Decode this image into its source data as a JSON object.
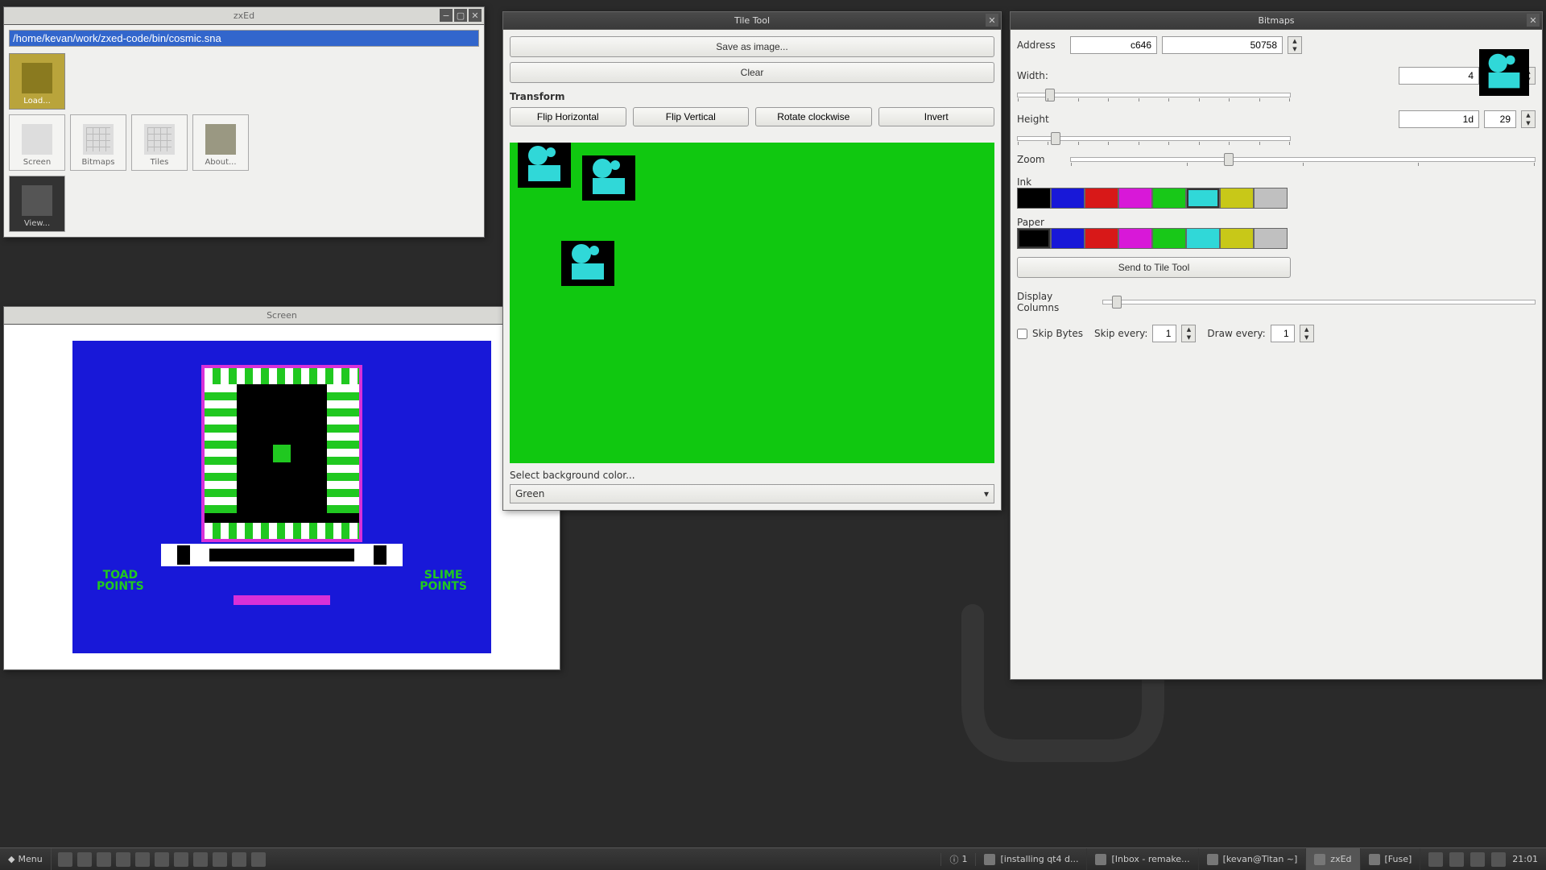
{
  "zxed": {
    "title": "zxEd",
    "path": "/home/kevan/work/zxed-code/bin/cosmic.sna",
    "tools": [
      {
        "label": "Load...",
        "active": true
      },
      {
        "label": "Screen"
      },
      {
        "label": "Bitmaps"
      },
      {
        "label": "Tiles"
      },
      {
        "label": "About..."
      },
      {
        "label": "View..."
      }
    ]
  },
  "screen": {
    "title": "Screen",
    "hud_left_1": "TOAD",
    "hud_left_2": "POINTS",
    "hud_right_1": "SLIME",
    "hud_right_2": "POINTS"
  },
  "tiletool": {
    "title": "Tile Tool",
    "save_label": "Save as image...",
    "clear_label": "Clear",
    "transform_label": "Transform",
    "flip_h": "Flip Horizontal",
    "flip_v": "Flip Vertical",
    "rotate": "Rotate clockwise",
    "invert": "Invert",
    "bg_label": "Select background color...",
    "bg_value": "Green"
  },
  "bitmaps": {
    "title": "Bitmaps",
    "address_label": "Address",
    "address_hex": "c646",
    "address_dec": "50758",
    "width_label": "Width:",
    "width_hex": "4",
    "width_dec": "4",
    "height_label": "Height",
    "height_hex": "1d",
    "height_dec": "29",
    "zoom_label": "Zoom",
    "ink_label": "Ink",
    "paper_label": "Paper",
    "send_label": "Send to Tile Tool",
    "display_cols_label": "Display Columns",
    "skip_bytes_label": "Skip Bytes",
    "skip_every_label": "Skip every:",
    "skip_every_value": "1",
    "draw_every_label": "Draw every:",
    "draw_every_value": "1",
    "palette": [
      "#000000",
      "#1818d8",
      "#d81818",
      "#d818d8",
      "#18c818",
      "#30d8d8",
      "#c8c818",
      "#c0c0c0"
    ],
    "ink_selected": 5,
    "paper_selected": 0
  },
  "taskbar": {
    "menu": "Menu",
    "workspace": "1",
    "items": [
      {
        "label": "[installing qt4 d..."
      },
      {
        "label": "[Inbox - remake..."
      },
      {
        "label": "[kevan@Titan ~]"
      },
      {
        "label": "zxEd",
        "active": true
      },
      {
        "label": "[Fuse]"
      }
    ],
    "clock": "21:01"
  }
}
